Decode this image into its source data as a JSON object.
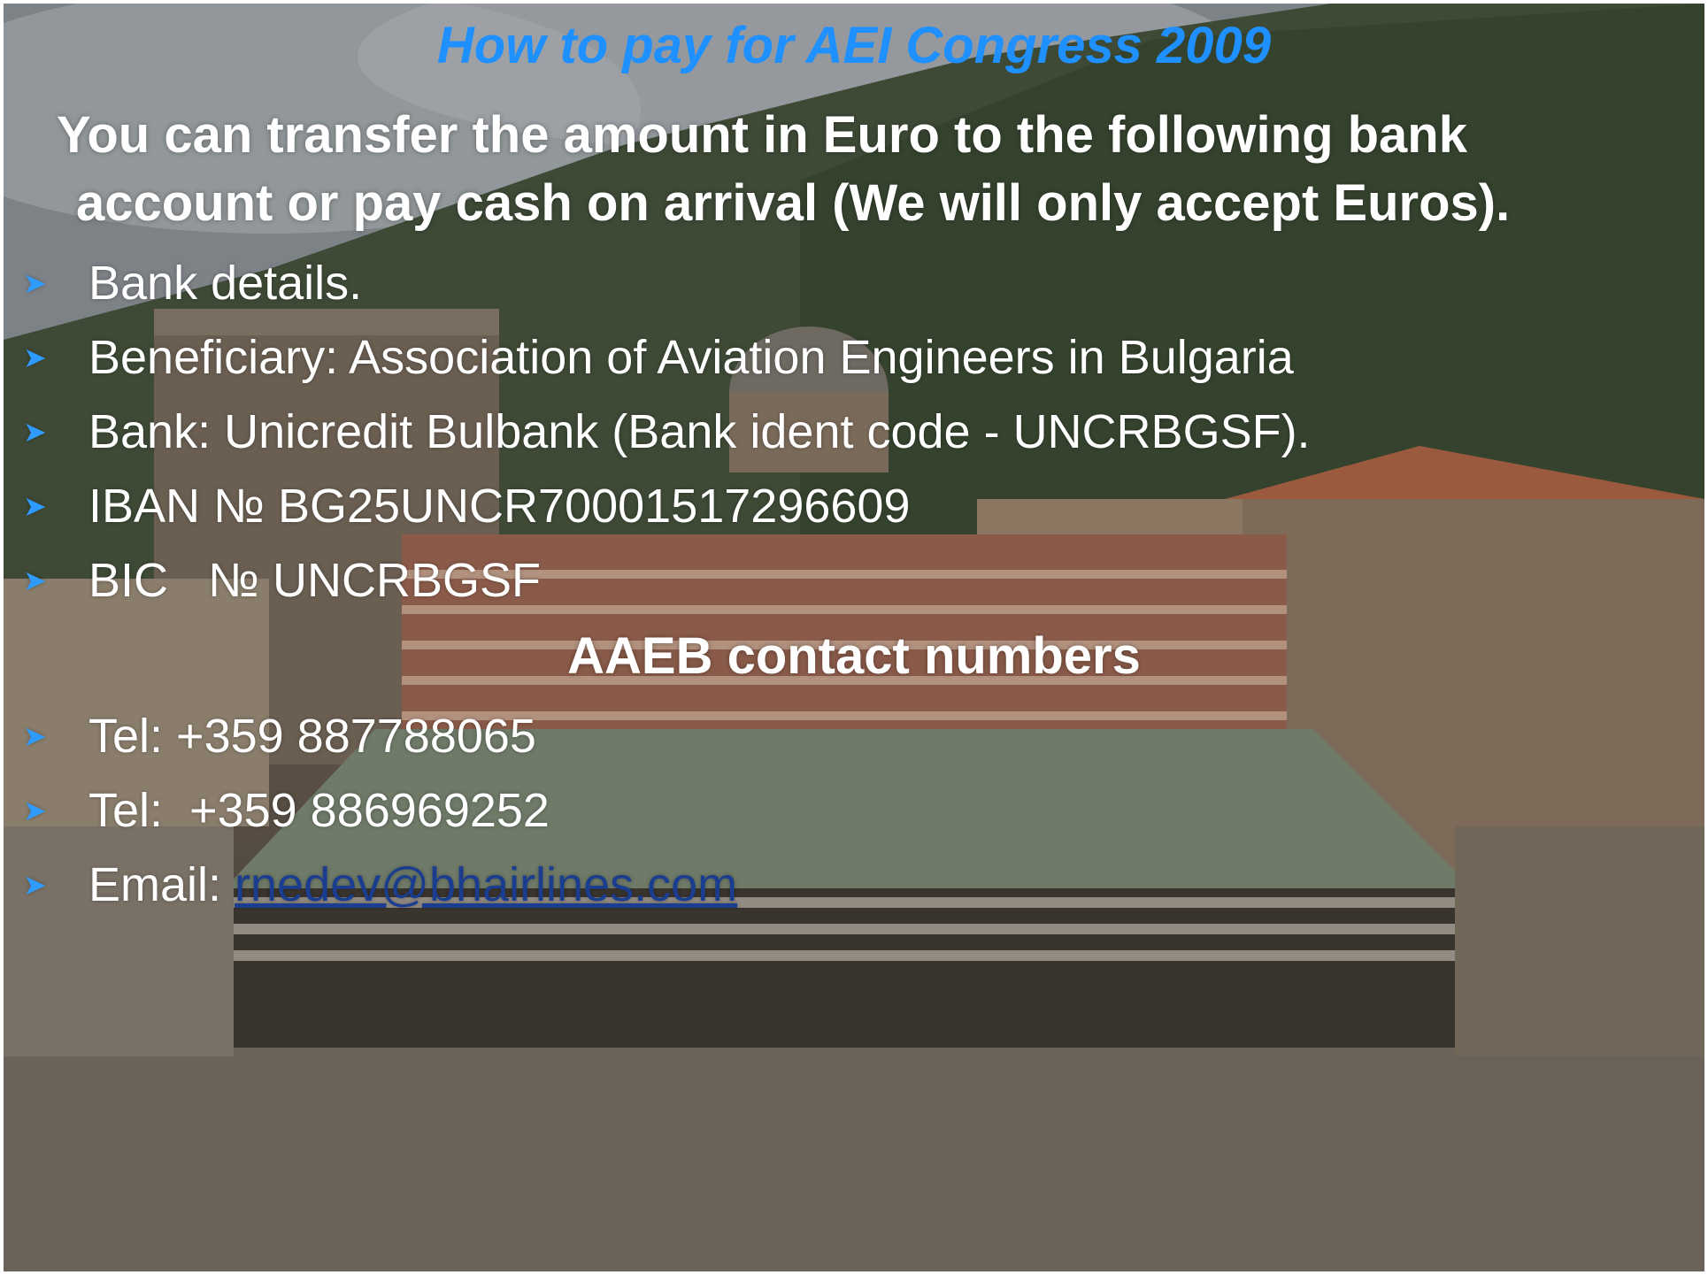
{
  "title": "How to pay for AEI Congress 2009",
  "intro": {
    "line1": "You can transfer the amount in Euro to the following bank",
    "line2": "account or pay cash on arrival (We will only accept Euros)."
  },
  "bullet_icon": "arrow-bullet-icon",
  "bullets": [
    "Bank details.",
    "Beneficiary: Association of Aviation Engineers in Bulgaria",
    "Bank: Unicredit Bulbank (Bank ident code - UNCRBGSF).",
    "IBAN № BG25UNCR70001517296609",
    "BIC   № UNCRBGSF"
  ],
  "contacts_heading": "AAEB contact numbers",
  "contacts": {
    "tel1": "Tel: +359 887788065",
    "tel2": "Tel:  +359 886969252",
    "email_label": "Email: ",
    "email": "rnedev@bhairlines.com"
  },
  "colors": {
    "title": "#1e90ff",
    "text": "#ffffff",
    "bullet": "#2f9bff",
    "link": "#1a3d8f"
  }
}
